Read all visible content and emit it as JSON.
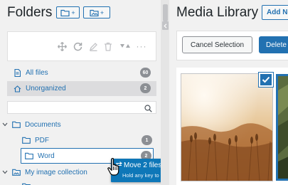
{
  "folders": {
    "title": "Folders",
    "new_folder_plus": "+",
    "new_gallery_plus": "+",
    "toolbar_icons": [
      "move-icon",
      "refresh-icon",
      "pencil-icon",
      "trash-icon",
      "sort-icon",
      "more-icon"
    ],
    "more_glyph": "···",
    "all_files": {
      "label": "All files",
      "count": "60"
    },
    "unorganized": {
      "label": "Unorganized",
      "count": "2"
    },
    "search": {
      "placeholder": "",
      "value": ""
    },
    "tree": [
      {
        "label": "Documents",
        "expanded": true,
        "children": [
          {
            "label": "PDF",
            "count": "1"
          },
          {
            "label": "Word",
            "count": "2"
          }
        ]
      },
      {
        "label": "My image collection",
        "expanded": true
      }
    ]
  },
  "drag_tooltip": {
    "title": "Move 2 files",
    "hint": "Hold any key to create a shortcut"
  },
  "media": {
    "title": "Media Library",
    "add_new": "Add New",
    "cancel_selection": "Cancel Selection",
    "delete": "Delete"
  },
  "colors": {
    "accent": "#2271b1",
    "badge": "#8c8f94",
    "tooltip": "#0e77b8"
  }
}
